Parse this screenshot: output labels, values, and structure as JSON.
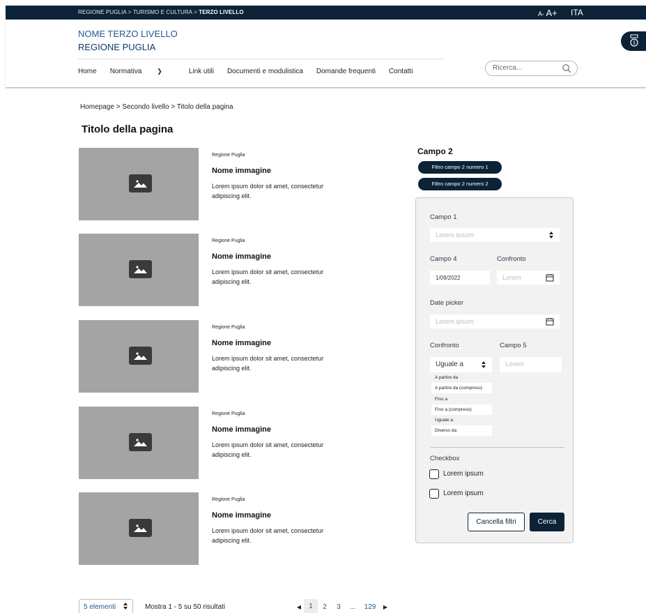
{
  "topbar": {
    "crumb_prefix": "REGIONE PUGLIA > TURISMO E CULTURA > ",
    "crumb_current": "TERZO LIVELLO",
    "text_small": "A-",
    "text_large": "A+",
    "language": "ITA"
  },
  "header": {
    "name_line1": "NOME TERZO LIVELLO",
    "name_line2": "REGIONE PUGLIA",
    "nav": [
      "Home",
      "Normativa",
      "Link utili",
      "Documenti e modulistica",
      "Domande frequenti",
      "Contatti"
    ],
    "search_placeholder": "Ricerca..."
  },
  "page": {
    "breadcrumb": "Homepage  >  Secondo livello > Titolo della pagina",
    "title": "Titolo della pagina"
  },
  "cards": [
    {
      "source": "Regione Puglia",
      "name": "Nome immagine",
      "desc": "Lorem ipsum dolor sit amet, consectetur adipiscing elit."
    },
    {
      "source": "Regione Puglia",
      "name": "Nome immagine",
      "desc": "Lorem ipsum dolor sit amet, consectetur adipiscing elit."
    },
    {
      "source": "Regione Puglia",
      "name": "Nome immagine",
      "desc": "Lorem ipsum dolor sit amet, consectetur adipiscing elit."
    },
    {
      "source": "Regione Puglia",
      "name": "Nome immagine",
      "desc": "Lorem ipsum dolor sit amet, consectetur adipiscing elit."
    },
    {
      "source": "Regione Puglia",
      "name": "Nome immagine",
      "desc": "Lorem ipsum dolor sit amet, consectetur adipiscing elit."
    }
  ],
  "filters": {
    "campo2_title": "Campo 2",
    "chips": [
      "Filtro campo 2 numero 1",
      "Filtro campo 2 numero 2"
    ],
    "campo1_label": "Campo 1",
    "campo1_placeholder": "Lorem ipsum",
    "campo4_label": "Campo 4",
    "campo4_value": "1/09/2022",
    "confronto_label": "Confronto",
    "confronto_placeholder": "Lorem",
    "datepicker_label": "Date picker",
    "datepicker_placeholder": "Lorem ipsum",
    "confronto2_label": "Confronto",
    "campo5_label": "Campo 5",
    "confronto2_value": "Uguale a",
    "campo5_placeholder": "Lorem",
    "options": [
      "A partire da",
      "A partire da (compreso)",
      "Fino a",
      "Fino a (compreso)",
      "Uguale a",
      "Diverso da"
    ],
    "checkbox_label": "Checkbox",
    "checkboxes": [
      "Lorem ipsum",
      "Lorem ipsum"
    ],
    "clear_button": "Cancella filtri",
    "search_button": "Cerca"
  },
  "footer": {
    "per_page": "5 elementi",
    "results": "Mostra 1 - 5 su 50 risultati",
    "pages": [
      "1",
      "2",
      "3",
      "...",
      "129"
    ],
    "current_page": "1"
  },
  "colors": {
    "primary": "#0c2237",
    "link": "#1f5a92",
    "placeholder_image": "#a4a4a4",
    "panel_bg": "#f2f2f2"
  }
}
